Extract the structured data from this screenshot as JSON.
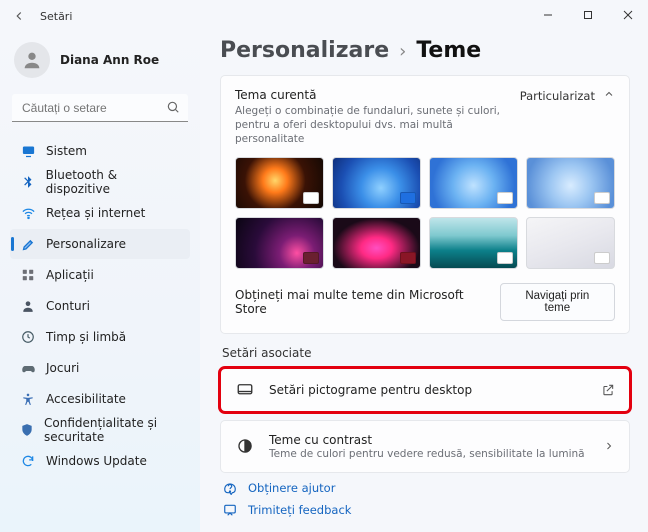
{
  "window": {
    "title": "Setări"
  },
  "profile": {
    "name": "Diana Ann Roe"
  },
  "search": {
    "placeholder": "Căutați o setare"
  },
  "sidebar": {
    "items": [
      {
        "label": "Sistem",
        "icon": "system",
        "color": "#1976d2"
      },
      {
        "label": "Bluetooth & dispozitive",
        "icon": "bluetooth",
        "color": "#1565c0"
      },
      {
        "label": "Rețea și internet",
        "icon": "wifi",
        "color": "#1e88e5"
      },
      {
        "label": "Personalizare",
        "icon": "personalize",
        "color": "#1976d2",
        "active": true
      },
      {
        "label": "Aplicații",
        "icon": "apps",
        "color": "#6d6f76"
      },
      {
        "label": "Conturi",
        "icon": "accounts",
        "color": "#4b5563"
      },
      {
        "label": "Timp și limbă",
        "icon": "time",
        "color": "#455a64"
      },
      {
        "label": "Jocuri",
        "icon": "gaming",
        "color": "#5e6b73"
      },
      {
        "label": "Accesibilitate",
        "icon": "accessibility",
        "color": "#3b6fb5"
      },
      {
        "label": "Confidențialitate și securitate",
        "icon": "privacy",
        "color": "#3a6fb0"
      },
      {
        "label": "Windows Update",
        "icon": "update",
        "color": "#1e88e5"
      }
    ]
  },
  "breadcrumb": {
    "parent": "Personalizare",
    "current": "Teme"
  },
  "themeCard": {
    "title": "Tema curentă",
    "subtitle": "Alegeți o combinație de fundaluri, sunete și culori, pentru a oferi desktopului dvs. mai multă personalitate",
    "status": "Particularizat",
    "storeText": "Obțineți mai multe teme din Microsoft Store",
    "browseBtn": "Navigați prin teme"
  },
  "relatedHeader": "Setări asociate",
  "rows": {
    "desktopIcons": {
      "title": "Setări pictograme pentru desktop"
    },
    "contrast": {
      "title": "Teme cu contrast",
      "subtitle": "Teme de culori pentru vedere redusă, sensibilitate la lumină"
    }
  },
  "footer": {
    "help": "Obținere ajutor",
    "feedback": "Trimiteți feedback"
  }
}
